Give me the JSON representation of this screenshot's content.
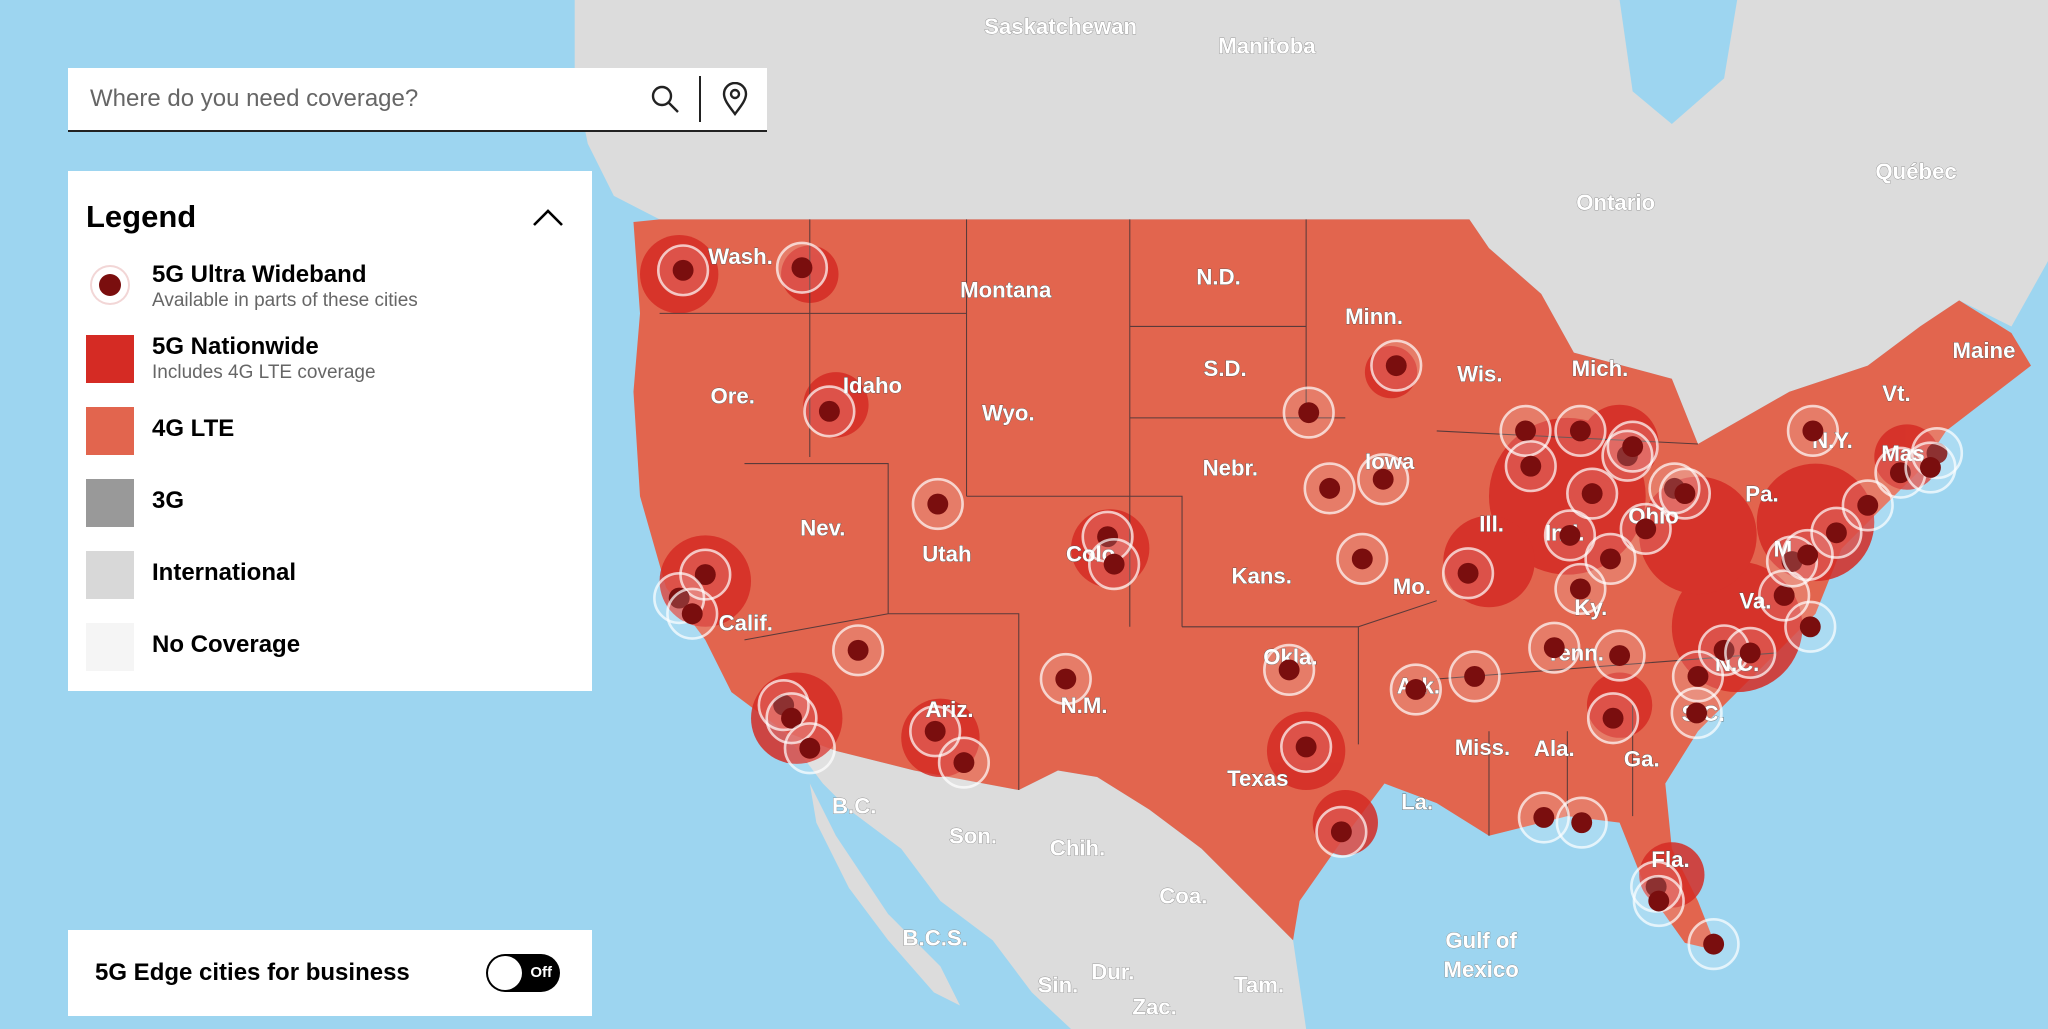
{
  "search": {
    "placeholder": "Where do you need coverage?",
    "value": "",
    "search_icon": "search-icon",
    "locate_icon": "location-pin-icon"
  },
  "legend": {
    "title": "Legend",
    "collapse_icon": "chevron-up-icon",
    "items": [
      {
        "label": "5G Ultra Wideband",
        "sub": "Available in parts of these cities",
        "color": "#7a0e0e"
      },
      {
        "label": "5G Nationwide",
        "sub": "Includes 4G LTE coverage",
        "color": "#d52b24"
      },
      {
        "label": "4G LTE",
        "sub": "",
        "color": "#e2654e"
      },
      {
        "label": "3G",
        "sub": "",
        "color": "#999999"
      },
      {
        "label": "International",
        "sub": "",
        "color": "#d8d8d8"
      },
      {
        "label": "No Coverage",
        "sub": "",
        "color": "#f5f5f5"
      }
    ]
  },
  "edge_toggle": {
    "label": "5G Edge cities for business",
    "state": "Off"
  },
  "map": {
    "colors": {
      "water": "#9dd5f0",
      "international": "#d8d8d8",
      "lte": "#e2654e",
      "nationwide": "#d52b24",
      "uwb": "#7a0e0e"
    },
    "region_labels": [
      "Saskatchewan",
      "Manitoba",
      "Ontario",
      "Québec",
      "B.C.",
      "Son.",
      "Chih.",
      "Coa.",
      "B.C.S.",
      "Dur.",
      "Sin.",
      "Tam.",
      "Zac.",
      "Gulf of",
      "Mexico"
    ],
    "state_labels": [
      "Wash.",
      "Montana",
      "N.D.",
      "Minn.",
      "Maine",
      "Idaho",
      "Ore.",
      "S.D.",
      "Wis.",
      "Mich.",
      "Vt.",
      "N.Y.",
      "Wyo.",
      "Nebr.",
      "Iowa",
      "Pa.",
      "Mas",
      "Nev.",
      "Utah",
      "Colo",
      "Ill.",
      "Ind.",
      "Ohio",
      "Kans.",
      "Mo.",
      "Ky.",
      "Va.",
      "M",
      "Calif.",
      "Okla.",
      "Tenn.",
      "N.C.",
      "Ariz.",
      "N.M.",
      "Ark.",
      "S.C.",
      "Miss.",
      "Ala.",
      "Ga.",
      "Texas",
      "La.",
      "Fla."
    ]
  }
}
